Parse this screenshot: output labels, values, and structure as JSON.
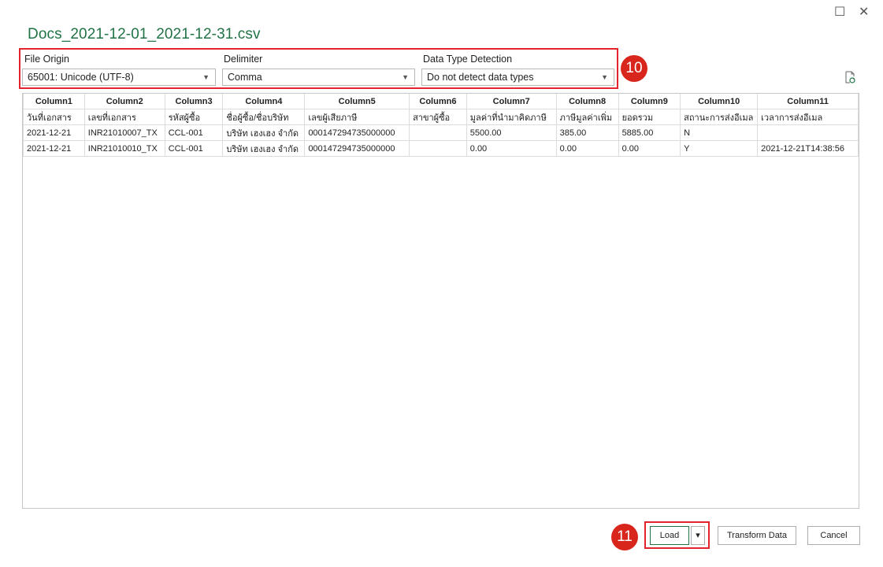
{
  "window": {
    "title": "Docs_2021-12-01_2021-12-31.csv",
    "maximize_glyph": "☐",
    "close_glyph": "✕"
  },
  "options": {
    "file_origin": {
      "label": "File Origin",
      "value": "65001: Unicode (UTF-8)"
    },
    "delimiter": {
      "label": "Delimiter",
      "value": "Comma"
    },
    "data_type_detection": {
      "label": "Data Type Detection",
      "value": "Do not detect data types"
    }
  },
  "callouts": {
    "options": "10",
    "load": "11"
  },
  "table": {
    "columns": [
      "Column1",
      "Column2",
      "Column3",
      "Column4",
      "Column5",
      "Column6",
      "Column7",
      "Column8",
      "Column9",
      "Column10",
      "Column11"
    ],
    "rows": [
      [
        "วันที่เอกสาร",
        "เลขที่เอกสาร",
        "รหัสผู้ซื้อ",
        "ชื่อผู้ซื้อ/ชื่อบริษัท",
        "เลขผู้เสียภาษี",
        "สาขาผู้ซื้อ",
        "มูลค่าที่นำมาคิดภาษี",
        "ภาษีมูลค่าเพิ่ม",
        "ยอดรวม",
        "สถานะการส่งอีเมล",
        "เวลาการส่งอีเมล"
      ],
      [
        "2021-12-21",
        "INR21010007_TX",
        "CCL-001",
        "บริษัท เฮงเฮง จำกัด",
        "000147294735000000",
        "",
        "5500.00",
        "385.00",
        "5885.00",
        "N",
        ""
      ],
      [
        "2021-12-21",
        "INR21010010_TX",
        "CCL-001",
        "บริษัท เฮงเฮง จำกัด",
        "000147294735000000",
        "",
        "0.00",
        "0.00",
        "0.00",
        "Y",
        "2021-12-21T14:38:56"
      ]
    ]
  },
  "buttons": {
    "load": "Load",
    "load_dropdown": "▾",
    "transform": "Transform Data",
    "cancel": "Cancel"
  },
  "colors": {
    "accent": "#217346",
    "highlight": "#e3242b",
    "callout": "#d9261c"
  }
}
